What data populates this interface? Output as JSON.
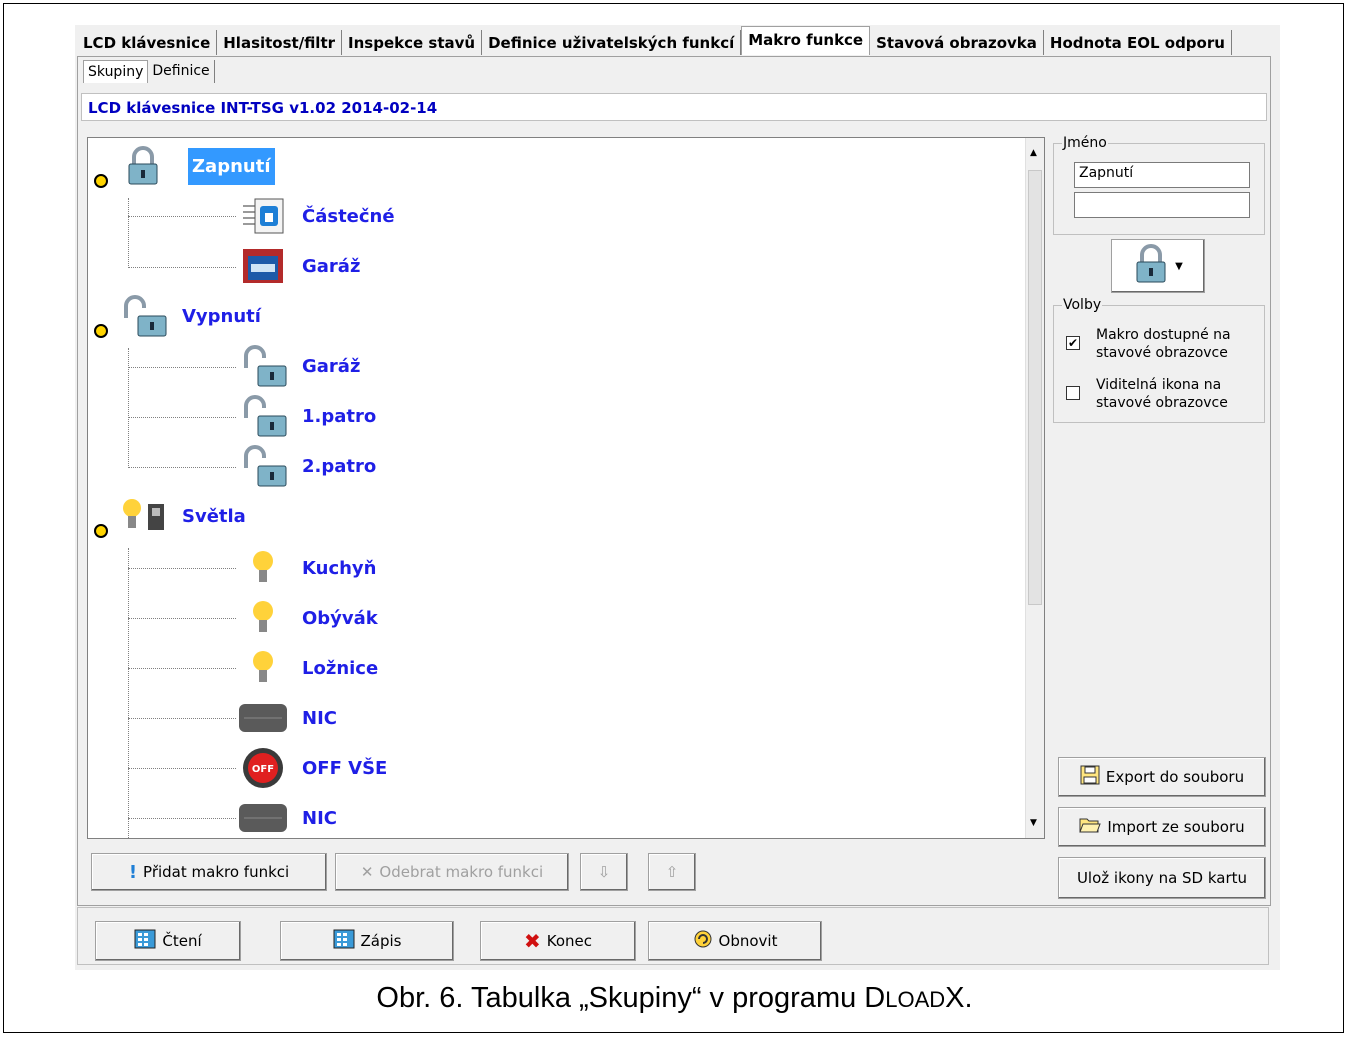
{
  "main_tabs": [
    "LCD klávesnice",
    "Hlasitost/filtr",
    "Inspekce stavů",
    "Definice uživatelských funkcí",
    "Makro funkce",
    "Stavová obrazovka",
    "Hodnota EOL odporu"
  ],
  "active_main_tab": "Makro funkce",
  "sub_tabs": [
    "Skupiny",
    "Definice"
  ],
  "active_sub_tab": "Skupiny",
  "info_bar": "LCD klávesnice INT-TSG v1.02 2014-02-14",
  "tree": {
    "groups": [
      {
        "label": "Zapnutí",
        "icon": "lock-closed-icon",
        "selected": true,
        "items": [
          {
            "label": "Částečné",
            "icon": "partial-arm-icon"
          },
          {
            "label": "Garáž",
            "icon": "garage-icon"
          }
        ]
      },
      {
        "label": "Vypnutí",
        "icon": "lock-open-icon",
        "items": [
          {
            "label": "Garáž",
            "icon": "lock-open-icon"
          },
          {
            "label": "1.patro",
            "icon": "lock-open-icon"
          },
          {
            "label": "2.patro",
            "icon": "lock-open-icon"
          }
        ]
      },
      {
        "label": "Světla",
        "icon": "bulb-switch-icon",
        "items": [
          {
            "label": "Kuchyň",
            "icon": "bulb-icon"
          },
          {
            "label": "Obývák",
            "icon": "bulb-icon"
          },
          {
            "label": "Ložnice",
            "icon": "bulb-icon"
          },
          {
            "label": "NIC",
            "icon": "blank-icon"
          },
          {
            "label": "OFF VŠE",
            "icon": "off-button-icon"
          },
          {
            "label": "NIC",
            "icon": "blank-icon"
          }
        ]
      }
    ]
  },
  "right_panel": {
    "name_group_title": "Jméno",
    "name_line1": "Zapnutí",
    "name_line2": "",
    "options_group_title": "Volby",
    "option1": "Makro dostupné na stavové obrazovce",
    "option1_checked": true,
    "option2": "Viditelná ikona na stavové obrazovce",
    "option2_checked": false,
    "export_button": "Export do souboru",
    "import_button": "Import ze souboru",
    "save_icons_button": "Ulož ikony na SD kartu"
  },
  "tree_buttons": {
    "add": "Přidat makro funkci",
    "remove": "Odebrat makro funkci"
  },
  "bottom_buttons": {
    "read": "Čtení",
    "write": "Zápis",
    "end": "Konec",
    "refresh": "Obnovit"
  },
  "caption": {
    "prefix": "Obr. 6. Tabulka „Skupiny“ v programu ",
    "prog_first": "D",
    "prog_small": "LOAD",
    "prog_last": "X."
  },
  "colors": {
    "tree_label": "#1f1fe6",
    "selection": "#3399ff",
    "info_text": "#0000c0"
  }
}
